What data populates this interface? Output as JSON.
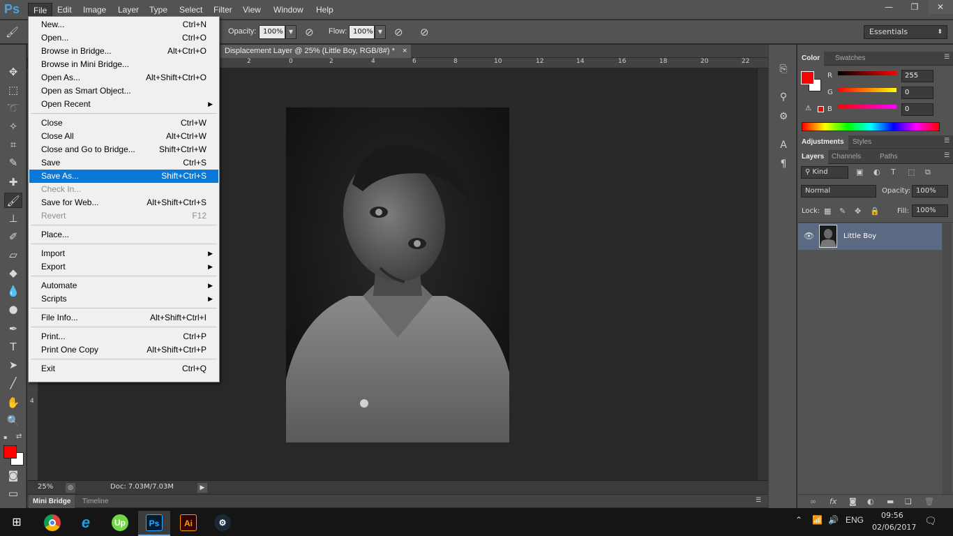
{
  "app": {
    "logo": "Ps"
  },
  "menubar": {
    "items": [
      "File",
      "Edit",
      "Image",
      "Layer",
      "Type",
      "Select",
      "Filter",
      "View",
      "Window",
      "Help"
    ],
    "active": "File"
  },
  "window_controls": {
    "minimize": "—",
    "restore": "❐",
    "close": "✕"
  },
  "options": {
    "opacity_label": "Opacity:",
    "opacity_value": "100%",
    "flow_label": "Flow:",
    "flow_value": "100%",
    "workspace": "Essentials"
  },
  "document": {
    "tab_title": "Displacement Layer @ 25% (Little Boy, RGB/8#) *",
    "tab_close": "×"
  },
  "ruler": {
    "h_ticks": [
      "2",
      "0",
      "2",
      "4",
      "6",
      "8",
      "10",
      "12",
      "14",
      "16",
      "18",
      "20",
      "22"
    ],
    "v_ticks": [
      "4"
    ]
  },
  "status": {
    "zoom": "25%",
    "doc": "Doc: 7.03M/7.03M"
  },
  "bottom_tabs": [
    "Mini Bridge",
    "Timeline"
  ],
  "file_menu": [
    {
      "label": "New...",
      "shortcut": "Ctrl+N"
    },
    {
      "label": "Open...",
      "shortcut": "Ctrl+O"
    },
    {
      "label": "Browse in Bridge...",
      "shortcut": "Alt+Ctrl+O"
    },
    {
      "label": "Browse in Mini Bridge...",
      "shortcut": ""
    },
    {
      "label": "Open As...",
      "shortcut": "Alt+Shift+Ctrl+O"
    },
    {
      "label": "Open as Smart Object...",
      "shortcut": ""
    },
    {
      "label": "Open Recent",
      "shortcut": "",
      "submenu": true
    },
    {
      "sep": true
    },
    {
      "label": "Close",
      "shortcut": "Ctrl+W"
    },
    {
      "label": "Close All",
      "shortcut": "Alt+Ctrl+W"
    },
    {
      "label": "Close and Go to Bridge...",
      "shortcut": "Shift+Ctrl+W"
    },
    {
      "label": "Save",
      "shortcut": "Ctrl+S"
    },
    {
      "label": "Save As...",
      "shortcut": "Shift+Ctrl+S",
      "highlighted": true
    },
    {
      "label": "Check In...",
      "shortcut": "",
      "disabled": true
    },
    {
      "label": "Save for Web...",
      "shortcut": "Alt+Shift+Ctrl+S"
    },
    {
      "label": "Revert",
      "shortcut": "F12",
      "disabled": true
    },
    {
      "sep": true
    },
    {
      "label": "Place...",
      "shortcut": ""
    },
    {
      "sep": true
    },
    {
      "label": "Import",
      "shortcut": "",
      "submenu": true
    },
    {
      "label": "Export",
      "shortcut": "",
      "submenu": true
    },
    {
      "sep": true
    },
    {
      "label": "Automate",
      "shortcut": "",
      "submenu": true
    },
    {
      "label": "Scripts",
      "shortcut": "",
      "submenu": true
    },
    {
      "sep": true
    },
    {
      "label": "File Info...",
      "shortcut": "Alt+Shift+Ctrl+I"
    },
    {
      "sep": true
    },
    {
      "label": "Print...",
      "shortcut": "Ctrl+P"
    },
    {
      "label": "Print One Copy",
      "shortcut": "Alt+Shift+Ctrl+P"
    },
    {
      "sep": true
    },
    {
      "label": "Exit",
      "shortcut": "Ctrl+Q"
    }
  ],
  "color_panel": {
    "tabs": [
      "Color",
      "Swatches"
    ],
    "r_label": "R",
    "g_label": "G",
    "b_label": "B",
    "r_value": "255",
    "g_value": "0",
    "b_value": "0",
    "foreground": "#ff0000",
    "background": "#ffffff"
  },
  "adjust_panel": {
    "tabs": [
      "Adjustments",
      "Styles"
    ]
  },
  "layers_panel": {
    "tabs": [
      "Layers",
      "Channels",
      "Paths"
    ],
    "filter_kind": "Kind",
    "blend_mode": "Normal",
    "opacity_label": "Opacity:",
    "opacity_value": "100%",
    "lock_label": "Lock:",
    "fill_label": "Fill:",
    "fill_value": "100%",
    "layers": [
      {
        "name": "Little Boy",
        "visible": true,
        "selected": true
      }
    ]
  },
  "taskbar": {
    "apps": [
      "chrome",
      "internet-explorer",
      "upwork",
      "photoshop",
      "illustrator",
      "steam"
    ],
    "ps_label": "Ps",
    "ai_label": "Ai",
    "up_label": "Up",
    "language": "ENG",
    "time": "09:56",
    "date": "02/06/2017"
  }
}
